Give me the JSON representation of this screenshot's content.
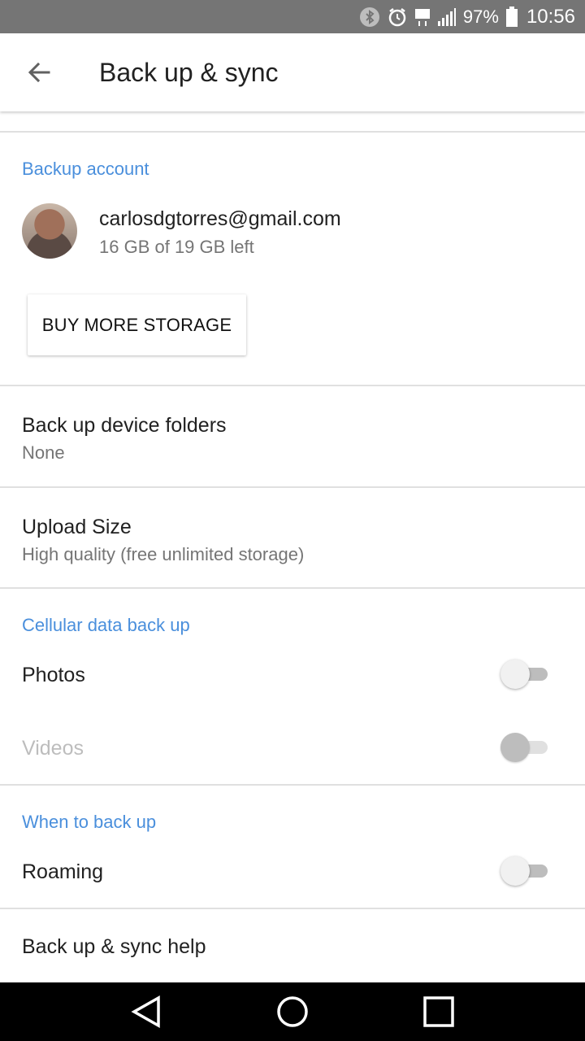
{
  "status_bar": {
    "battery_percent": "97%",
    "time": "10:56",
    "network_label": "LTE",
    "icons": [
      "bluetooth-icon",
      "alarm-icon",
      "lte-icon",
      "signal-icon",
      "battery-icon"
    ]
  },
  "app_bar": {
    "title": "Back up & sync",
    "back_icon": "arrow-back-icon"
  },
  "backup_account": {
    "header": "Backup account",
    "email": "carlosdgtorres@gmail.com",
    "storage": "16 GB of 19 GB left",
    "buy_button_label": "BUY MORE STORAGE"
  },
  "device_folders": {
    "title": "Back up device folders",
    "value": "None"
  },
  "upload_size": {
    "title": "Upload Size",
    "value": "High quality (free unlimited storage)"
  },
  "cellular": {
    "header": "Cellular data back up",
    "photos_label": "Photos",
    "photos_on": false,
    "videos_label": "Videos",
    "videos_on": false,
    "videos_enabled": false
  },
  "when": {
    "header": "When to back up",
    "roaming_label": "Roaming",
    "roaming_on": false
  },
  "help": {
    "label": "Back up & sync help"
  },
  "colors": {
    "accent": "#4a8fdc",
    "status_bar": "#757575",
    "nav_bar": "#000000"
  },
  "nav_bar": {
    "icons": [
      "nav-back-icon",
      "nav-home-icon",
      "nav-recents-icon"
    ]
  }
}
